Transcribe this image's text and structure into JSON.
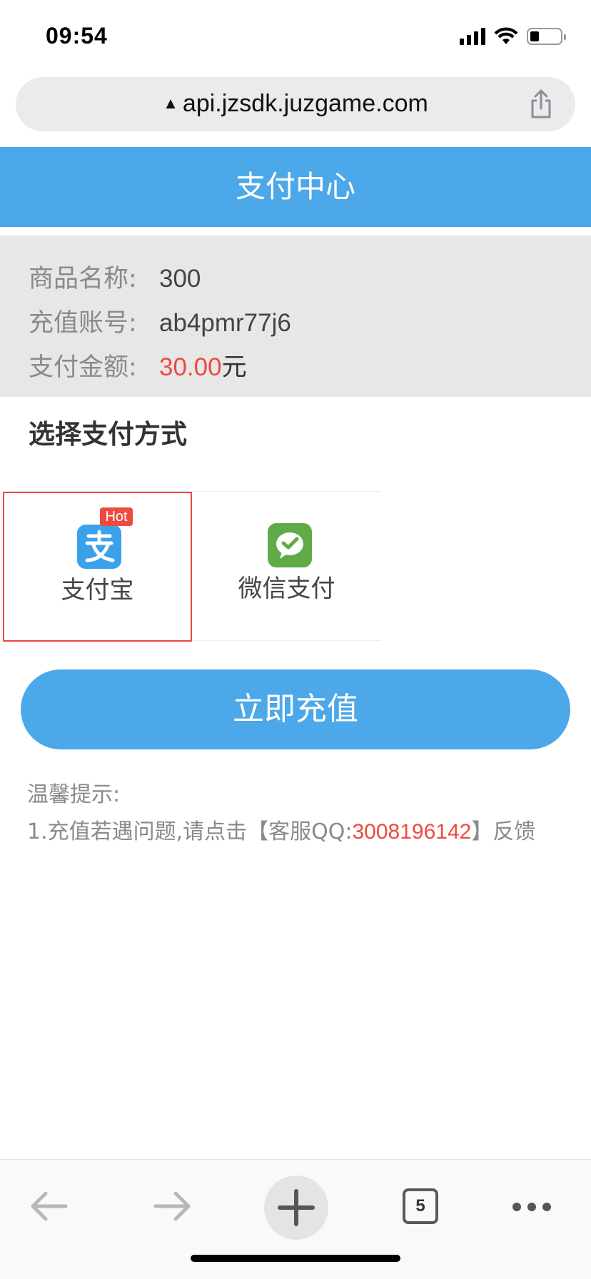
{
  "status_bar": {
    "time": "09:54"
  },
  "address_bar": {
    "url": "api.jzsdk.juzgame.com",
    "warning_glyph": "▲"
  },
  "header": {
    "title": "支付中心"
  },
  "order": {
    "rows": [
      {
        "label": "商品名称:",
        "value": "300"
      },
      {
        "label": "充值账号:",
        "value": "ab4pmr77j6"
      },
      {
        "label": "支付金额:",
        "amount": "30.00",
        "unit": "元"
      }
    ]
  },
  "payment": {
    "section_title": "选择支付方式",
    "options": [
      {
        "label": "支付宝",
        "badge": "Hot",
        "selected": true
      },
      {
        "label": "微信支付",
        "selected": false
      }
    ]
  },
  "actions": {
    "recharge_label": "立即充值"
  },
  "tips": {
    "title": "温馨提示:",
    "line_prefix": "1.充值若遇问题,请点击【客服QQ:",
    "qq": "3008196142",
    "line_suffix": "】反馈"
  },
  "toolbar": {
    "tab_count": "5"
  },
  "colors": {
    "brand_blue": "#4ca8e8",
    "accent_red": "#ee4a3f",
    "alipay_blue": "#3ba1ea",
    "wechat_green": "#5eab47"
  }
}
